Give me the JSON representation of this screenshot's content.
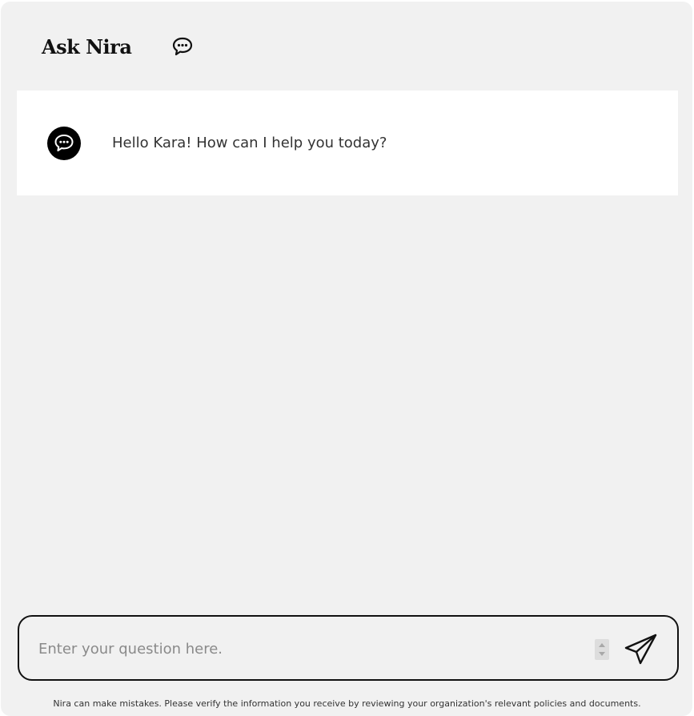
{
  "header": {
    "title": "Ask Nira",
    "icon": "chat-bubble-icon"
  },
  "chat": {
    "messages": [
      {
        "sender_icon": "chat-bubble-icon",
        "text": "Hello Kara! How can I help you today?"
      }
    ]
  },
  "composer": {
    "placeholder": "Enter your question here.",
    "value": "",
    "send_icon": "paper-plane-icon"
  },
  "footer": {
    "disclaimer": "Nira can make mistakes. Please verify the information you receive by reviewing your organization's relevant policies and documents."
  },
  "colors": {
    "background": "#f1f1f1",
    "card": "#ffffff",
    "text": "#333333",
    "accent": "#111111"
  }
}
